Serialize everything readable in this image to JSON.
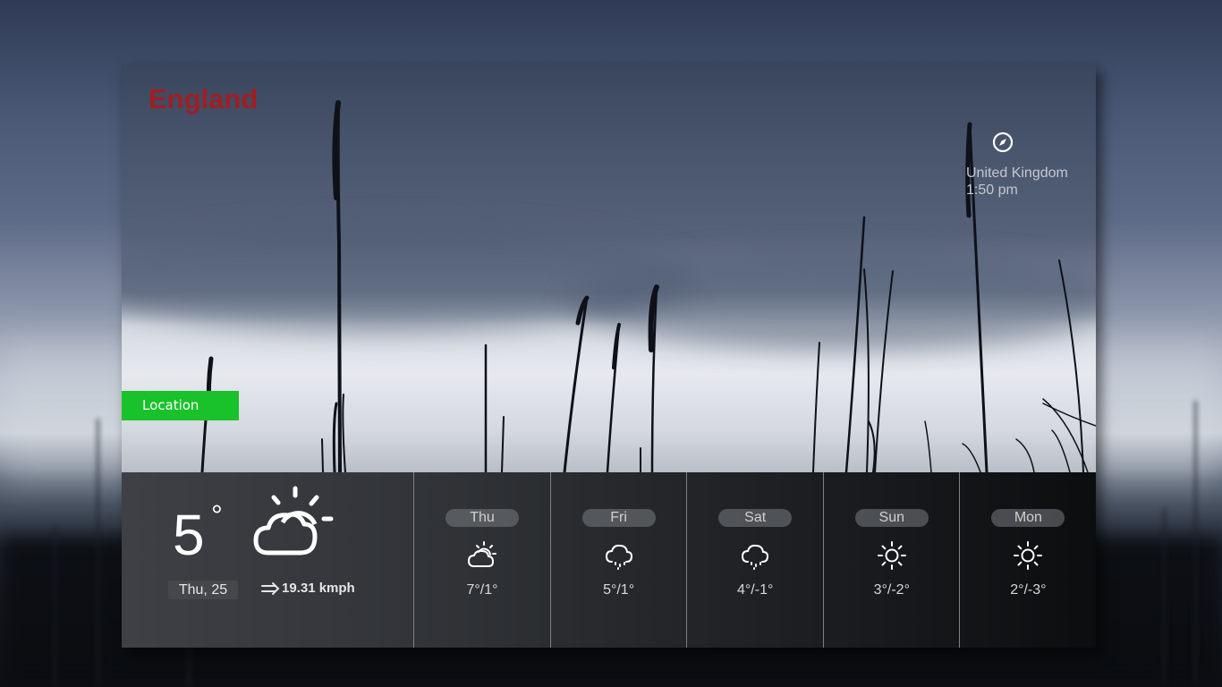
{
  "header": {
    "title": "England"
  },
  "geo": {
    "country": "United Kingdom",
    "time": "1:50 pm",
    "icon": "compass-icon"
  },
  "location_button": {
    "label": "Location"
  },
  "current": {
    "temperature": "5",
    "degree_symbol": "°",
    "icon": "sun-behind-cloud-icon",
    "date": "Thu, 25",
    "wind": "19.31 kmph",
    "wind_icon": "wind-arrow-icon"
  },
  "forecast": [
    {
      "day": "Thu",
      "temp": "7°/1°",
      "icon": "partly-cloudy-icon"
    },
    {
      "day": "Fri",
      "temp": "5°/1°",
      "icon": "rain-icon"
    },
    {
      "day": "Sat",
      "temp": "4°/-1°",
      "icon": "rain-icon"
    },
    {
      "day": "Sun",
      "temp": "3°/-2°",
      "icon": "sun-icon"
    },
    {
      "day": "Mon",
      "temp": "2°/-3°",
      "icon": "sun-icon"
    }
  ],
  "colors": {
    "title": "#a01e22",
    "location_button": "#19c22a"
  }
}
